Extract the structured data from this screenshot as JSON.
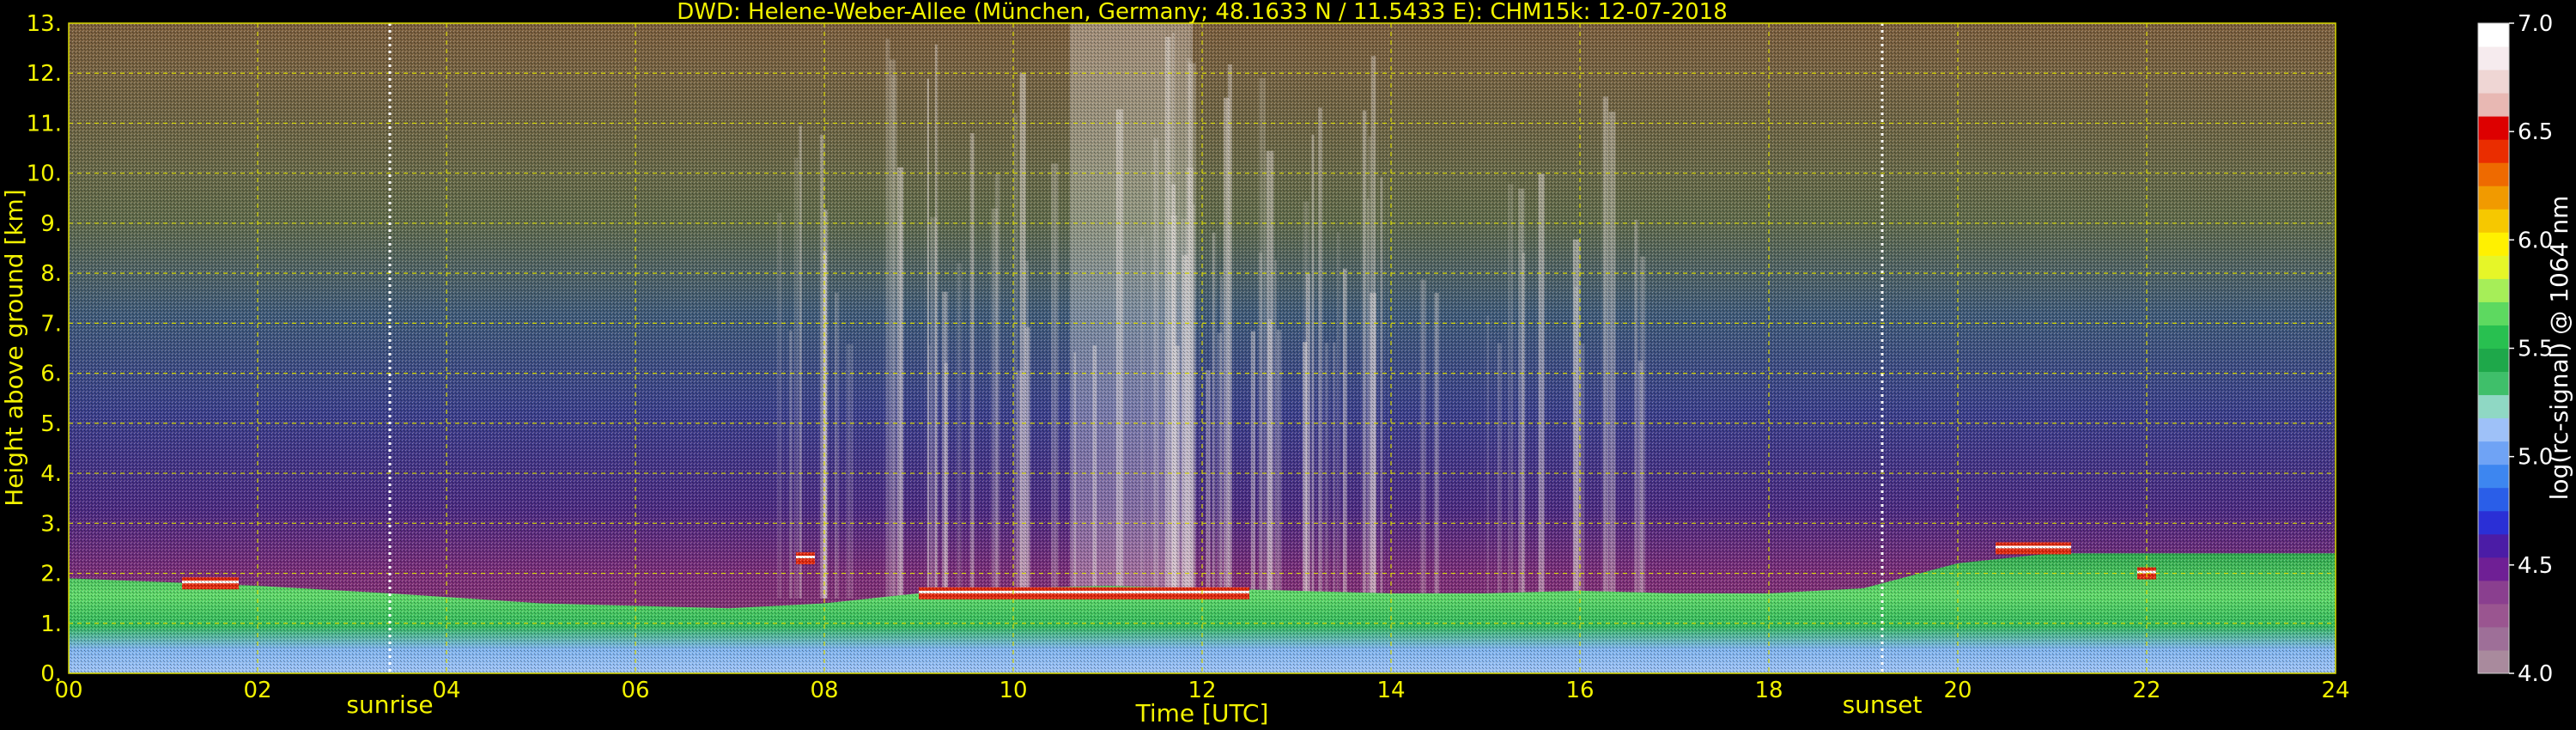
{
  "chart_data": {
    "type": "heatmap",
    "title": "DWD: Helene-Weber-Allee (München, Germany; 48.1633 N / 11.5433 E):    CHM15k: 12-07-2018",
    "xlabel": "Time [UTC]",
    "ylabel": "Height above ground [km]",
    "xlim": [
      0,
      24
    ],
    "ylim": [
      0,
      13
    ],
    "x_ticks": [
      "00",
      "02",
      "04",
      "06",
      "08",
      "10",
      "12",
      "14",
      "16",
      "18",
      "20",
      "22",
      "24"
    ],
    "y_ticks": [
      "0.",
      "1.",
      "2.",
      "3.",
      "4.",
      "5.",
      "6.",
      "7.",
      "8.",
      "9.",
      "10.",
      "11.",
      "12.",
      "13."
    ],
    "grid": true,
    "annotations": [
      {
        "text": "sunrise",
        "x": 3.4
      },
      {
        "text": "sunset",
        "x": 19.2
      }
    ],
    "colorbar": {
      "label": "log(rc-signal) @ 1064 nm",
      "range": [
        4.0,
        7.0
      ],
      "ticks": [
        "4.0",
        "4.5",
        "5.0",
        "5.5",
        "6.0",
        "6.5",
        "7.0"
      ]
    },
    "features": {
      "boundary_layer_top_km": [
        [
          0,
          1.9
        ],
        [
          2,
          1.75
        ],
        [
          3.4,
          1.6
        ],
        [
          5,
          1.4
        ],
        [
          7,
          1.3
        ],
        [
          8,
          1.4
        ],
        [
          9,
          1.6
        ],
        [
          10,
          1.7
        ],
        [
          11,
          1.75
        ],
        [
          12,
          1.7
        ],
        [
          13,
          1.65
        ],
        [
          14,
          1.6
        ],
        [
          15,
          1.6
        ],
        [
          16,
          1.65
        ],
        [
          17,
          1.6
        ],
        [
          18,
          1.6
        ],
        [
          19,
          1.7
        ],
        [
          20,
          2.2
        ],
        [
          21,
          2.4
        ],
        [
          22,
          2.4
        ],
        [
          23,
          2.4
        ],
        [
          24,
          2.4
        ]
      ],
      "cloud_layers": [
        {
          "x_start": 1.2,
          "x_end": 1.8,
          "height_km": 1.8
        },
        {
          "x_start": 7.7,
          "x_end": 7.9,
          "height_km": 2.3
        },
        {
          "x_start": 9.0,
          "x_end": 12.5,
          "height_km": 1.6
        },
        {
          "x_start": 20.4,
          "x_end": 21.2,
          "height_km": 2.5
        },
        {
          "x_start": 21.9,
          "x_end": 22.1,
          "height_km": 2.0
        }
      ]
    },
    "colors": {
      "text": "#f2f200",
      "grid": "#d8d800",
      "sun_lines": "#ffffff",
      "background": "#000000",
      "colorbar": [
        "#a98a9d",
        "#9e6f98",
        "#9a5590",
        "#8a3f8f",
        "#6f1f95",
        "#4b1ca6",
        "#2a2fd6",
        "#2a5ee8",
        "#3d86f0",
        "#6fa3f5",
        "#9ec1f8",
        "#8fd8c4",
        "#3fbf6a",
        "#1ea84a",
        "#28c050",
        "#5dd960",
        "#a6ee58",
        "#e6f628",
        "#fff100",
        "#f6c800",
        "#f19a00",
        "#ee6a00",
        "#ea2d00",
        "#dd0000",
        "#e8b8b3",
        "#efd6d4",
        "#f6ebee",
        "#ffffff"
      ]
    }
  }
}
